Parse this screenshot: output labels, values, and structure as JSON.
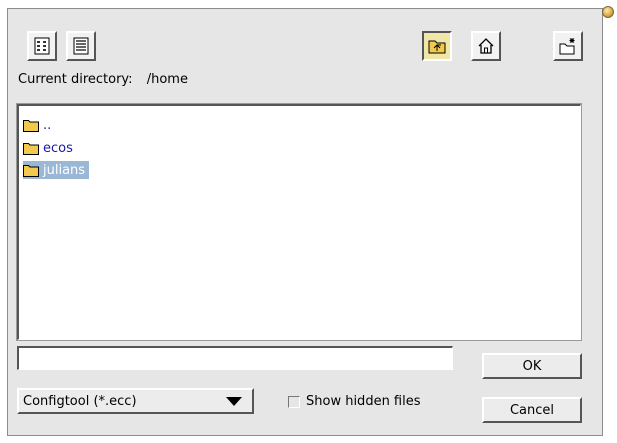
{
  "toolbar": {
    "buttons": [
      {
        "icon": "list-view-icon"
      },
      {
        "icon": "detail-view-icon"
      },
      {
        "icon": "parent-directory-icon"
      },
      {
        "icon": "home-icon"
      },
      {
        "icon": "new-folder-icon"
      }
    ]
  },
  "location": {
    "label": "Current directory:",
    "path": "/home"
  },
  "files": [
    {
      "name": "..",
      "type": "folder",
      "selected": false
    },
    {
      "name": "ecos",
      "type": "folder",
      "selected": false
    },
    {
      "name": "julians",
      "type": "folder",
      "selected": true
    }
  ],
  "filename_input": {
    "value": "",
    "placeholder": ""
  },
  "filter": {
    "selected": "Configtool (*.ecc)"
  },
  "show_hidden": {
    "label": "Show hidden files",
    "checked": false
  },
  "buttons": {
    "ok": "OK",
    "cancel": "Cancel"
  },
  "colors": {
    "dialog_bg": "#e6e6e6",
    "selection": "#9ab7d6",
    "folder_name": "#1a1aa6",
    "folder_icon": "#f2c94c"
  }
}
